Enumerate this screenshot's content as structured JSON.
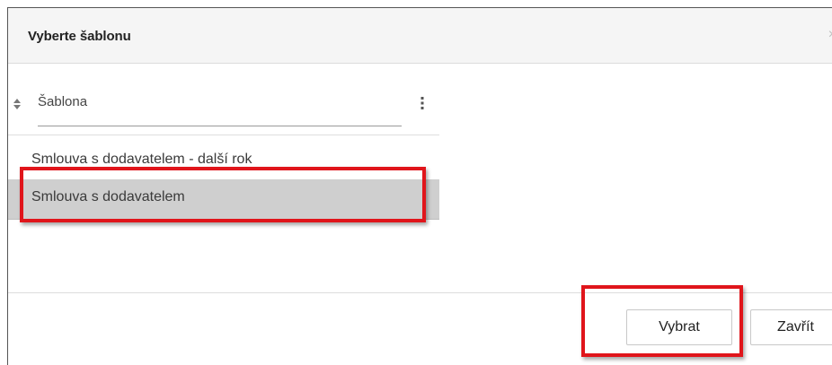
{
  "dialog": {
    "title": "Vyberte šablonu",
    "close_glyph": "×"
  },
  "table": {
    "column_header": "Šablona",
    "sort_icon": "sort-updown-icon",
    "menu_icon": "vertical-ellipsis-icon",
    "rows": [
      {
        "label": "Smlouva s dodavatelem - další rok",
        "selected": false
      },
      {
        "label": "Smlouva s dodavatelem",
        "selected": true
      }
    ]
  },
  "footer": {
    "select_label": "Vybrat",
    "close_label": "Zavřít"
  },
  "colors": {
    "highlight": "#e0151b",
    "selected_row": "#cfcfcf",
    "header_bg": "#f5f5f5"
  }
}
